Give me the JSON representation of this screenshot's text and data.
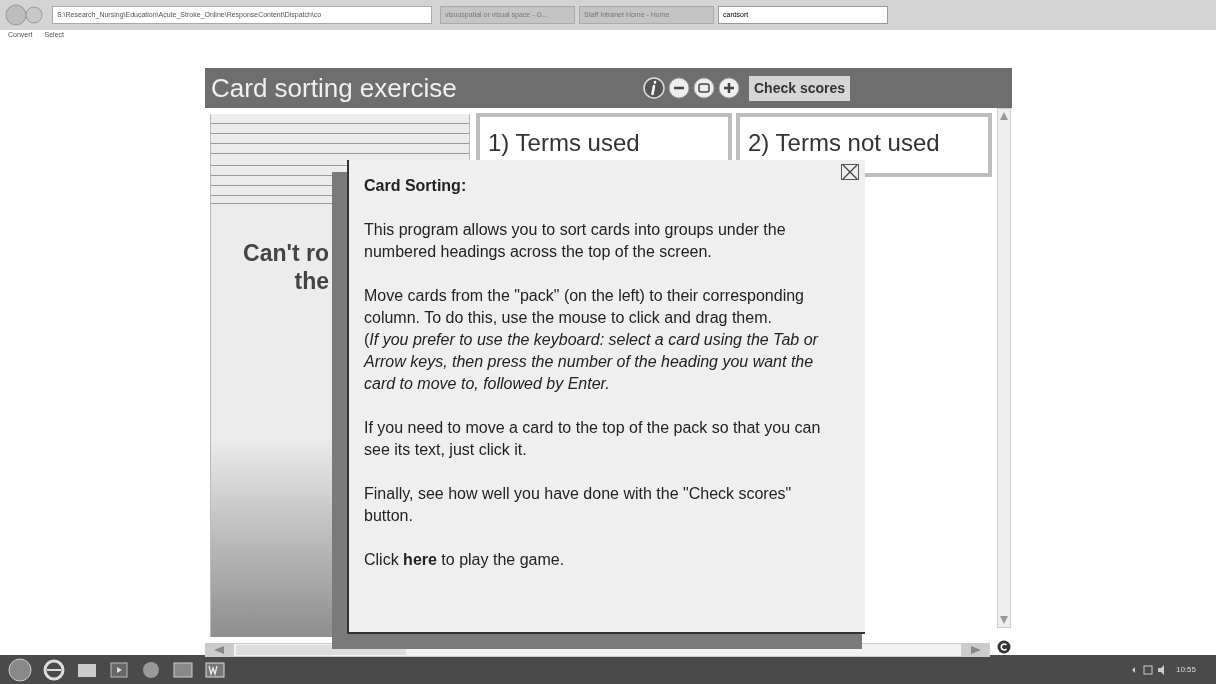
{
  "browser": {
    "address": "S:\\Research_Nursing\\Education\\Acute_Stroke_Online\\ResponseContent\\Dispatch\\co",
    "tabs": [
      {
        "label": "visuospatial or visual space - G...",
        "selected": false
      },
      {
        "label": "Staff Intranet Home - Home",
        "selected": false
      },
      {
        "label": "cardsort",
        "selected": true
      }
    ],
    "command_bar": [
      "Convert",
      "Select"
    ]
  },
  "app": {
    "title": "Card sorting exercise",
    "check_scores_button": "Check scores",
    "pack": {
      "card_text": [
        "Can't ro",
        "the"
      ]
    },
    "columns": [
      "1) Terms used",
      "2) Terms not used"
    ],
    "dialog": {
      "title": "Card Sorting:",
      "paragraphs": [
        [
          "This program allows you to sort cards into groups under the numbered headings across the top of the screen."
        ],
        [
          "Move cards from the \"pack\" (on the left) to their corresponding column. To do this, use the mouse to click and drag them.",
          "(*If you prefer to use the keyboard: select a card using the Tab or Arrow keys, then press the number of the heading you want the card to move to, followed by Enter.*"
        ],
        [
          "If you need to move a card to the top of the pack so that you can see its text, just click it."
        ],
        [
          "Finally, see how well you have done with the \"Check scores\" button."
        ],
        [
          "Click **here** to play the game."
        ]
      ]
    }
  },
  "taskbar": {
    "time": "10:55"
  }
}
